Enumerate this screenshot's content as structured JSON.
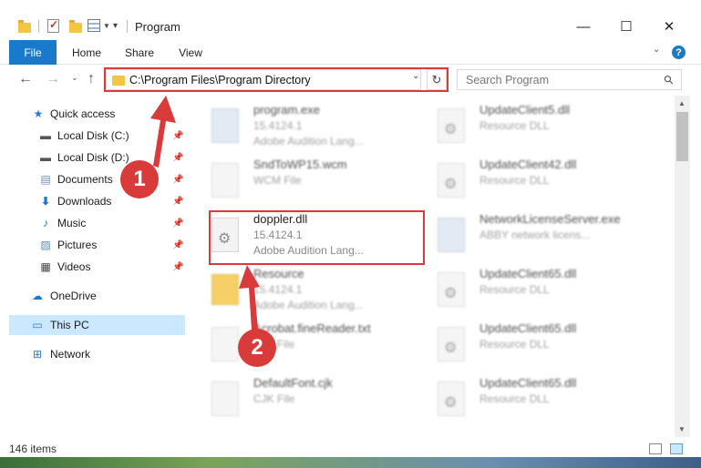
{
  "window": {
    "title": "Program",
    "minimize": "—",
    "maximize": "☐",
    "close": "✕"
  },
  "ribbon": {
    "tabs": [
      "File",
      "Home",
      "Share",
      "View"
    ],
    "help": "?"
  },
  "navbar": {
    "address": "C:\\Program Files\\Program Directory",
    "search_placeholder": "Search Program"
  },
  "sidebar": {
    "items": [
      {
        "label": "Quick access",
        "icon": "star-icon"
      },
      {
        "label": "Local Disk (C:)",
        "icon": "drive-icon"
      },
      {
        "label": "Local Disk (D:)",
        "icon": "drive-icon"
      },
      {
        "label": "Documents",
        "icon": "documents-icon"
      },
      {
        "label": "Downloads",
        "icon": "downloads-icon"
      },
      {
        "label": "Music",
        "icon": "music-icon"
      },
      {
        "label": "Pictures",
        "icon": "pictures-icon"
      },
      {
        "label": "Videos",
        "icon": "videos-icon"
      },
      {
        "label": "OneDrive",
        "icon": "cloud-icon"
      },
      {
        "label": "This PC",
        "icon": "computer-icon"
      },
      {
        "label": "Network",
        "icon": "network-icon"
      }
    ]
  },
  "files": {
    "left": [
      {
        "name": "program.exe",
        "line1": "15.4124.1",
        "line2": "Adobe Audition Lang..."
      },
      {
        "name": "SndToWP15.wcm",
        "line1": "WCM File",
        "line2": ""
      },
      {
        "name": "doppler.dll",
        "line1": "15.4124.1",
        "line2": "Adobe Audition Lang..."
      },
      {
        "name": "Resource",
        "line1": "15.4124.1",
        "line2": "Adobe Audition Lang..."
      },
      {
        "name": "Acrobat.fineReader.txt",
        "line1": "TXT File",
        "line2": ""
      },
      {
        "name": "DefaultFont.cjk",
        "line1": "CJK File",
        "line2": ""
      }
    ],
    "right": [
      {
        "name": "UpdateClient5.dll",
        "line1": "Resource DLL",
        "line2": ""
      },
      {
        "name": "UpdateClient42.dll",
        "line1": "Resource DLL",
        "line2": ""
      },
      {
        "name": "NetworkLicenseServer.exe",
        "line1": "ABBY network licens...",
        "line2": ""
      },
      {
        "name": "UpdateClient65.dll",
        "line1": "Resource DLL",
        "line2": ""
      },
      {
        "name": "UpdateClient65.dll",
        "line1": "Resource DLL",
        "line2": ""
      },
      {
        "name": "UpdateClient65.dll",
        "line1": "Resource DLL",
        "line2": ""
      }
    ]
  },
  "status": {
    "item_count": "146 items"
  },
  "annotations": {
    "step1": "1",
    "step2": "2"
  },
  "colors": {
    "accent": "#1979ca",
    "highlight": "#d93a3a",
    "selected": "#cce8ff"
  }
}
